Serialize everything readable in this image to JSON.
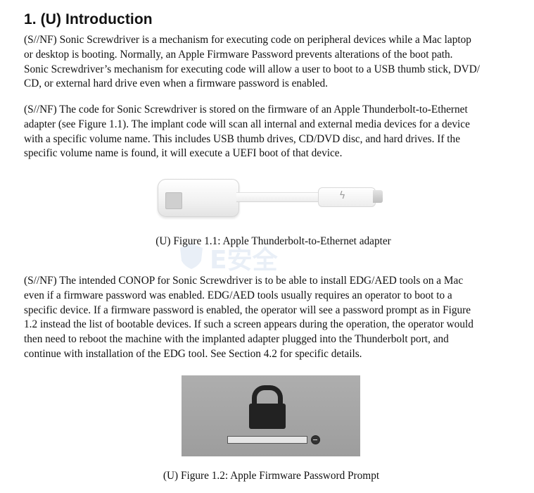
{
  "heading": "1.  (U) Introduction",
  "para1": [
    "(S//NF) Sonic Screwdriver is a mechanism for executing code on peripheral devices while a Mac laptop",
    "or desktop is booting.  Normally, an Apple Firmware Password prevents alterations of the boot path.",
    "Sonic Screwdriver’s mechanism for executing code will allow a user to boot to a USB thumb stick, DVD/",
    "CD, or external hard drive even when a firmware password is enabled."
  ],
  "para2": [
    "(S//NF) The code for Sonic Screwdriver is stored on the firmware of an Apple Thunderbolt-to-Ethernet",
    "adapter (see Figure 1.1).  The implant code will scan all internal and external media devices for a device",
    "with a specific volume name.  This includes USB thumb drives, CD/DVD disc, and hard drives.  If the",
    "specific volume name is found, it will execute a UEFI boot of that device."
  ],
  "figure1_caption": "(U) Figure 1.1: Apple Thunderbolt-to-Ethernet adapter",
  "para3": [
    "(S//NF) The intended CONOP for Sonic Screwdriver is to be able to install EDG/AED tools on a Mac",
    "even if a firmware password was enabled.  EDG/AED tools usually requires an operator to boot to a",
    "specific device.  If a firmware password is enabled, the operator will see a password prompt as in Figure",
    "1.2 instead the list of bootable devices.  If such a screen appears during the operation, the operator would",
    "then need to reboot the machine with the implanted adapter plugged into the Thunderbolt port, and",
    "continue with installation of the EDG tool.  See Section 4.2 for specific details."
  ],
  "figure2_caption": "(U) Figure 1.2: Apple Firmware Password Prompt",
  "watermark": "E安全",
  "icons": {
    "thunderbolt": "thunderbolt-icon",
    "lock": "lock-icon",
    "submit": "arrow-circle-icon"
  }
}
